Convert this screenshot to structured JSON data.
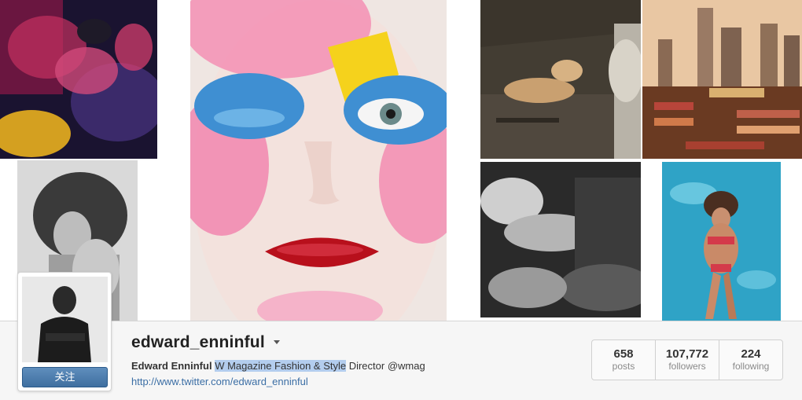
{
  "profile": {
    "username": "edward_enninful",
    "follow_label": "关注",
    "full_name": "Edward Enninful",
    "bio_highlight": "W Magazine Fashion & Style",
    "bio_rest": " Director @wmag",
    "website": "http://www.twitter.com/edward_enninful"
  },
  "stats": [
    {
      "value": "658",
      "label": "posts"
    },
    {
      "value": "107,772",
      "label": "followers"
    },
    {
      "value": "224",
      "label": "following"
    }
  ],
  "colors": {
    "follow_button": "#3f6fa0",
    "link": "#3b6ea5",
    "selection": "#b3cdee"
  }
}
